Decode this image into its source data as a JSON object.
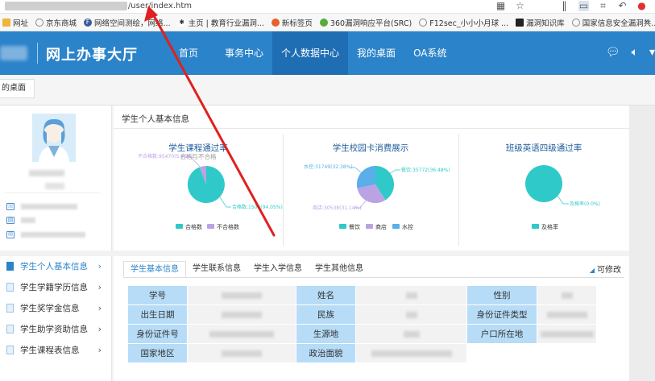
{
  "browser": {
    "url_path": "/user/index.htm",
    "bookmarks": [
      {
        "label": "网址",
        "icon": "folder-icon",
        "color": "#f0b43b"
      },
      {
        "label": "京东商城",
        "icon": "globe-icon",
        "color": "#888888"
      },
      {
        "label": "网络空间测绘，网络...",
        "icon": "fofa-icon",
        "color": "#3a5a9a"
      },
      {
        "label": "主页 | 教育行业漏洞...",
        "icon": "bug-icon",
        "color": "#333333"
      },
      {
        "label": "新标签页",
        "icon": "firefox-icon",
        "color": "#e8602c"
      },
      {
        "label": "360漏洞响应平台(SRC)",
        "icon": "360-icon",
        "color": "#5aa93c"
      },
      {
        "label": "F12sec_小小小月球 ...",
        "icon": "globe-icon",
        "color": "#888888"
      },
      {
        "label": "漏洞知识库",
        "icon": "dark-square-icon",
        "color": "#222222"
      },
      {
        "label": "国家信息安全漏洞共...",
        "icon": "globe-icon",
        "color": "#888888"
      }
    ]
  },
  "header": {
    "title": "网上办事大厅",
    "nav": [
      "首页",
      "事务中心",
      "个人数据中心",
      "我的桌面",
      "OA系统"
    ],
    "active_nav": "个人数据中心",
    "color": "#2b83c9"
  },
  "tabstrip": {
    "desk_tab": "的桌面"
  },
  "left_menu": [
    {
      "label": "学生个人基本信息",
      "active": true
    },
    {
      "label": "学生学籍学历信息",
      "active": false
    },
    {
      "label": "学生奖学金信息",
      "active": false
    },
    {
      "label": "学生助学资助信息",
      "active": false
    },
    {
      "label": "学生课程表信息",
      "active": false
    }
  ],
  "stats": {
    "title": "学生个人基本信息",
    "charts": [
      {
        "title": "学生课程通过率",
        "subtitle": "合格与不合格",
        "label_pass": "合格数:1506(94.05%)",
        "label_fail": "不合格数:95470(5.95%)",
        "legend": [
          "合格数",
          "不合格数"
        ],
        "colors": [
          "#30c9c9",
          "#b9a3e3"
        ]
      },
      {
        "title": "学生校园卡消费展示",
        "label_a": "餐饮:35772(36.48%)",
        "label_b": "商店:30538(31.14%)",
        "label_c": "水控:31749(32.38%)",
        "legend": [
          "餐饮",
          "商店",
          "水控"
        ],
        "colors": [
          "#30c9c9",
          "#b9a3e3",
          "#5aaee9"
        ]
      },
      {
        "title": "班级英语四级通过率",
        "label_pass": "及格率(0.0%)",
        "legend": [
          "及格率"
        ],
        "colors": [
          "#30c9c9"
        ]
      }
    ],
    "chart_data": [
      {
        "type": "pie",
        "title": "学生课程通过率",
        "subtitle": "合格与不合格",
        "categories": [
          "合格数",
          "不合格数"
        ],
        "values": [
          94.05,
          5.95
        ]
      },
      {
        "type": "pie",
        "title": "学生校园卡消费展示",
        "categories": [
          "餐饮",
          "商店",
          "水控"
        ],
        "values": [
          35772,
          30538,
          31749
        ],
        "percents": [
          36.48,
          31.14,
          32.38
        ]
      },
      {
        "type": "pie",
        "title": "班级英语四级通过率",
        "categories": [
          "及格率"
        ],
        "values": [
          100
        ]
      }
    ]
  },
  "detail": {
    "tabs": [
      "学生基本信息",
      "学生联系信息",
      "学生入学信息",
      "学生其他信息"
    ],
    "active_tab": "学生基本信息",
    "modify_label": "可修改",
    "rows": [
      [
        "学号",
        "姓名",
        "性别"
      ],
      [
        "出生日期",
        "民族",
        "身份证件类型"
      ],
      [
        "身份证件号",
        "生源地",
        "户口所在地"
      ],
      [
        "国家地区",
        "政治面貌",
        ""
      ]
    ]
  }
}
